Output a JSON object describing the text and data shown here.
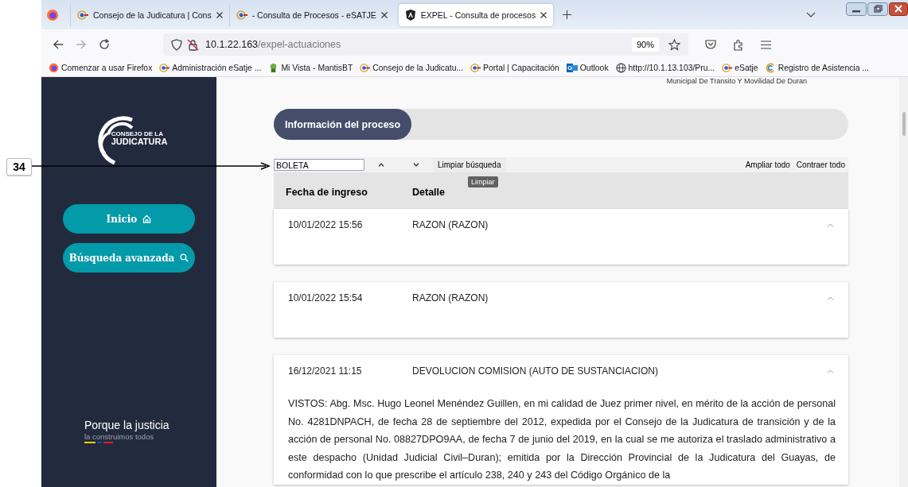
{
  "annotation": {
    "label": "34"
  },
  "browser": {
    "tabs": [
      {
        "title": "Consejo de la Judicatura | Cons",
        "kind": "site",
        "selected": false
      },
      {
        "title": "- Consulta de Procesos - eSATJE",
        "kind": "site",
        "selected": false
      },
      {
        "title": "EXPEL - Consulta de procesos",
        "kind": "angular",
        "selected": true
      }
    ],
    "address": {
      "host": "10.1.22.163",
      "path": "/expel-actuaciones"
    },
    "zoom": "90%",
    "bookmarks": [
      {
        "label": "Comenzar a usar Firefox",
        "kind": "firefox"
      },
      {
        "label": "Administración eSatje ...",
        "kind": "site"
      },
      {
        "label": "Mi Vista - MantisBT",
        "kind": "bug"
      },
      {
        "label": "Consejo de la Judicatu...",
        "kind": "site"
      },
      {
        "label": "Portal | Capacitación",
        "kind": "site"
      },
      {
        "label": "Outlook",
        "kind": "mail"
      },
      {
        "label": "http://10.1.13.103/Pru...",
        "kind": "globe"
      },
      {
        "label": "eSatje",
        "kind": "site"
      },
      {
        "label": "Registro de Asistencia ...",
        "kind": "ring"
      }
    ]
  },
  "sidebar": {
    "logo_lines": [
      "CONSEJO DE LA",
      "JUDICATURA"
    ],
    "buttons": [
      {
        "label": "Inicio",
        "kind": "home"
      },
      {
        "label": "Búsqueda avanzada",
        "kind": "search"
      }
    ],
    "slogan": "Porque la justicia",
    "slogan_sub": "la construimos todos"
  },
  "page": {
    "header_text": "Municipal De Transito Y Movilidad De Duran",
    "tabs": [
      {
        "label": "Información del proceso",
        "selected": true
      }
    ],
    "search": {
      "value": "BOLETA"
    },
    "clear_button": "Limpiar búsqueda",
    "tooltip": "Limpiar",
    "expand_all": "Ampliar todo",
    "collapse_all": "Contraer todo",
    "columns": [
      "Fecha de ingreso",
      "Detalle"
    ],
    "entries": [
      {
        "date": "10/01/2022 15:56",
        "title": "RAZON (RAZON)",
        "expanded": true
      },
      {
        "date": "10/01/2022 15:54",
        "title": "RAZON (RAZON)",
        "expanded": true
      },
      {
        "date": "16/12/2021 11:15",
        "title": "DEVOLUCION COMISION (AUTO DE SUSTANCIACION)",
        "expanded": true,
        "body": "VISTOS: Abg. Msc. Hugo Leonel Menéndez Guillen, en mi calidad de Juez primer nivel, en mérito de la acción de personal No. 4281DNPACH, de fecha 28 de septiembre del 2012, expedida por el Consejo de la Judicatura de transición y de la acción de personal No. 08827DPO9AA, de fecha 7 de junio del 2019, en la cual se me autoriza el traslado administrativo a este despacho (Unidad Judicial Civil–Duran); emitida por la Dirección Provincial de la Judicatura del Guayas, de conformidad con lo que prescribe el artículo 238, 240 y 243 del Código Orgánico de la"
      }
    ]
  }
}
